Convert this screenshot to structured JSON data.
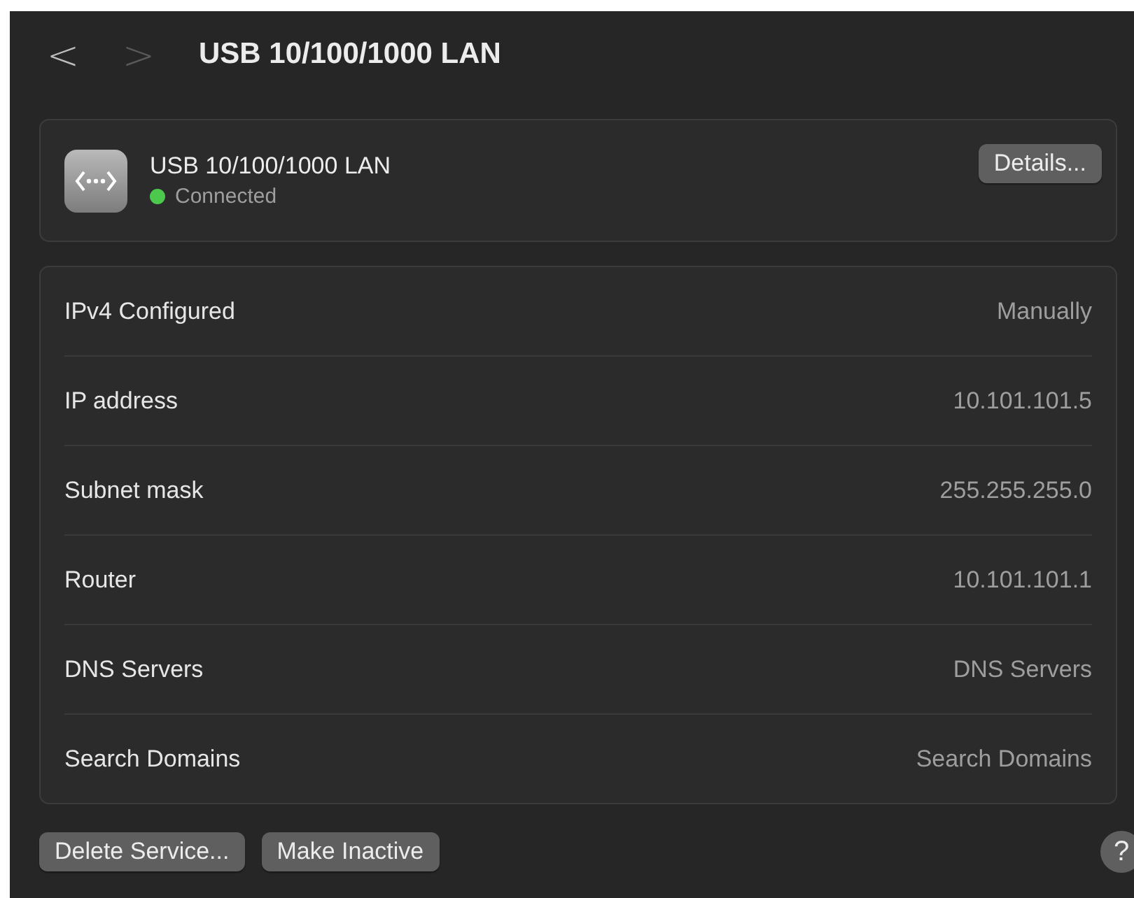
{
  "toolbar": {
    "back": {
      "label": "<",
      "disabled": false
    },
    "forward": {
      "label": ">",
      "disabled": true
    },
    "title": "USB 10/100/1000 LAN"
  },
  "service": {
    "name": "USB 10/100/1000 LAN",
    "status": "Connected",
    "connected": true,
    "details_button": "Details..."
  },
  "settings": [
    {
      "label": "IPv4 Configured",
      "value": "Manually"
    },
    {
      "label": "IP address",
      "value": "10.101.101.5"
    },
    {
      "label": "Subnet mask",
      "value": "255.255.255.0"
    },
    {
      "label": "Router",
      "value": "10.101.101.1"
    },
    {
      "label": "DNS Servers",
      "value": "DNS Servers"
    },
    {
      "label": "Search Domains",
      "value": "Search Domains"
    }
  ],
  "buttons": [
    "Delete Service...",
    "Make Inactive"
  ],
  "help_button": "?"
}
